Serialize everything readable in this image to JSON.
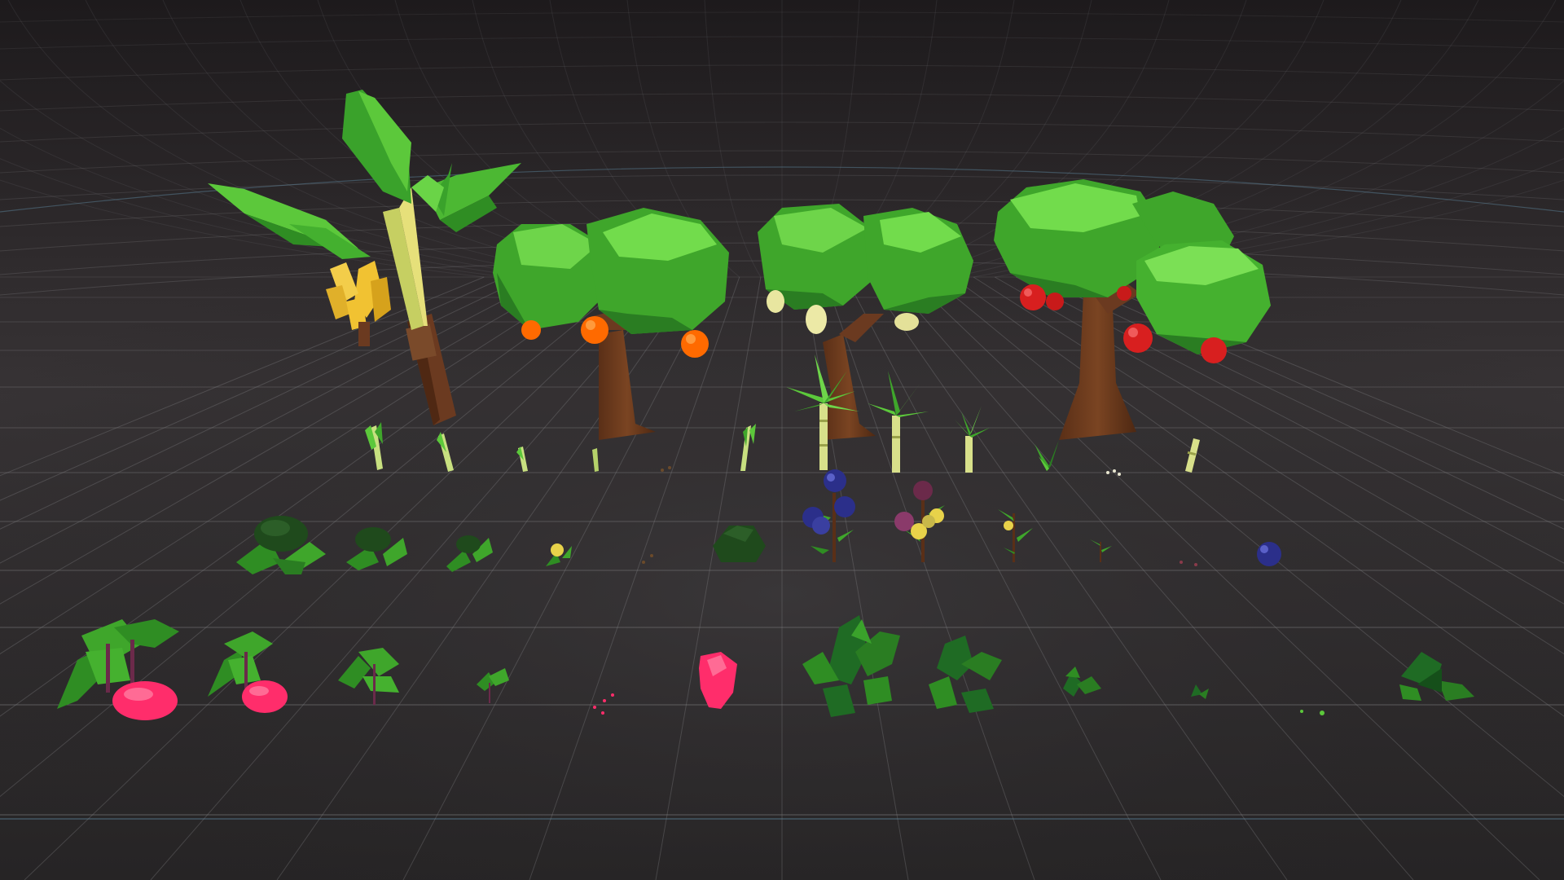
{
  "scene": {
    "colors": {
      "background_top": "#1f1c1e",
      "background_mid": "#2e2b2d",
      "background_floor": "#2a282a",
      "grid_line": "#8a8a8c",
      "grid_accent": "#6fa9c9",
      "leaf_light": "#6fd84a",
      "leaf_mid": "#3fa62b",
      "leaf_dark": "#1f6b24",
      "trunk": "#6b3a1e",
      "banana": "#f1c232",
      "orange": "#ff6a00",
      "pear": "#e8e6a0",
      "apple": "#d81f1f",
      "blueberry": "#2b2f8a",
      "beet": "#ff2d6b",
      "corn_stalk": "#d8e08a"
    },
    "rows": [
      {
        "name": "trees-row",
        "items": [
          {
            "name": "banana-tree",
            "fruit": "banana-icon"
          },
          {
            "name": "orange-tree",
            "fruit": "orange-icon"
          },
          {
            "name": "pear-tree",
            "fruit": "pear-icon"
          },
          {
            "name": "apple-tree",
            "fruit": "apple-icon"
          }
        ]
      },
      {
        "name": "sprouts-row",
        "items": [
          {
            "name": "leek-sprout-large"
          },
          {
            "name": "leek-sprout-medium"
          },
          {
            "name": "leek-sprout-small"
          },
          {
            "name": "leek-sprout-tiny"
          },
          {
            "name": "seeds"
          },
          {
            "name": "leek-sprout-alt"
          },
          {
            "name": "sugarcane-large"
          },
          {
            "name": "sugarcane-medium"
          },
          {
            "name": "sugarcane-small"
          },
          {
            "name": "sugarcane-sprout"
          },
          {
            "name": "seeds-small"
          },
          {
            "name": "sugarcane-stalk"
          }
        ]
      },
      {
        "name": "bushes-row",
        "items": [
          {
            "name": "bush-large"
          },
          {
            "name": "bush-medium"
          },
          {
            "name": "bush-small"
          },
          {
            "name": "bush-sprout"
          },
          {
            "name": "soil-seeds"
          },
          {
            "name": "shrub-round"
          },
          {
            "name": "blueberry-bush"
          },
          {
            "name": "berry-bush-mixed"
          },
          {
            "name": "berry-bush-young"
          },
          {
            "name": "berry-sprout"
          },
          {
            "name": "berry-seeds"
          },
          {
            "name": "blueberry-fruit"
          }
        ]
      },
      {
        "name": "root-crops-row",
        "items": [
          {
            "name": "beet-plant-large"
          },
          {
            "name": "beet-plant-medium"
          },
          {
            "name": "beet-plant-small"
          },
          {
            "name": "beet-sprout"
          },
          {
            "name": "beet-seeds"
          },
          {
            "name": "beet-root"
          },
          {
            "name": "leafy-plant-large"
          },
          {
            "name": "leafy-plant-medium"
          },
          {
            "name": "leafy-plant-small"
          },
          {
            "name": "leafy-sprout"
          },
          {
            "name": "leafy-seeds"
          },
          {
            "name": "leafy-plant-lowpoly"
          }
        ]
      }
    ]
  }
}
